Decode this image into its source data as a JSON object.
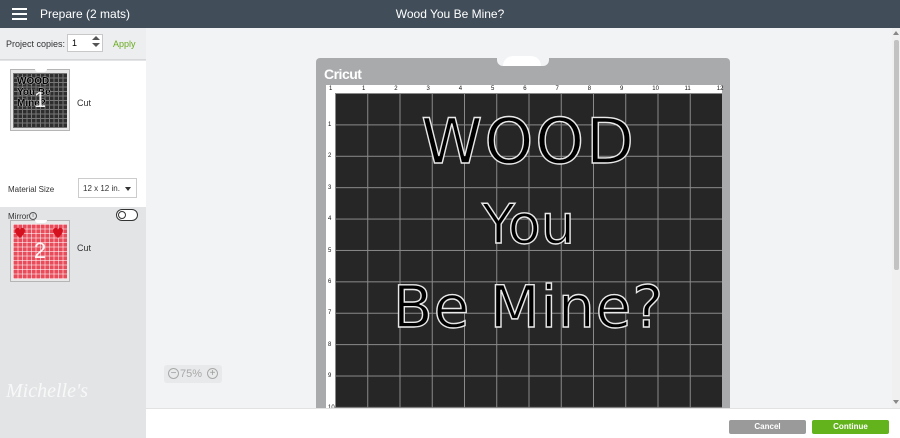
{
  "header": {
    "prepare_title": "Prepare (2 mats)",
    "project_title": "Wood You Be Mine?"
  },
  "sidebar": {
    "project_copies_label": "Project copies:",
    "project_copies_value": "1",
    "apply_label": "Apply",
    "mats": [
      {
        "number": "1",
        "label": "Cut",
        "thumb_text": "WOOD You Be Mine?",
        "color": "#2d2d2d"
      },
      {
        "number": "2",
        "label": "Cut",
        "color": "#e84c5a"
      }
    ],
    "material_size_label": "Material Size",
    "material_size_value": "12 x 12 in.",
    "mirror_label": "Mirror",
    "mirror_on": false,
    "watermark": "Michelle's"
  },
  "mat": {
    "logo": "Cricut",
    "top_ruler": [
      "1",
      "2",
      "3",
      "4",
      "5",
      "6",
      "7",
      "8",
      "9",
      "10",
      "11",
      "12"
    ],
    "side_ruler": [
      "1",
      "2",
      "3",
      "4",
      "5",
      "6",
      "7",
      "8",
      "9",
      "10"
    ],
    "design_lines": [
      "WOOD",
      "You",
      "Be Mine?"
    ]
  },
  "zoom": {
    "minus": "−",
    "value": "75%",
    "plus": "+"
  },
  "footer": {
    "cancel_label": "Cancel",
    "continue_label": "Continue"
  },
  "colors": {
    "topbar": "#414e5a",
    "accent_green": "#62b31c",
    "mat_grey": "#a9aaac"
  }
}
